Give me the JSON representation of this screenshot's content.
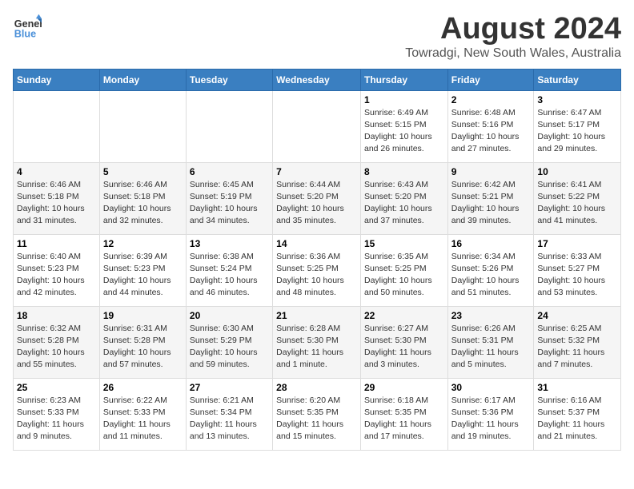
{
  "header": {
    "logo_line1": "General",
    "logo_line2": "Blue",
    "month_year": "August 2024",
    "location": "Towradgi, New South Wales, Australia"
  },
  "weekdays": [
    "Sunday",
    "Monday",
    "Tuesday",
    "Wednesday",
    "Thursday",
    "Friday",
    "Saturday"
  ],
  "weeks": [
    {
      "days": [
        {
          "num": "",
          "info": ""
        },
        {
          "num": "",
          "info": ""
        },
        {
          "num": "",
          "info": ""
        },
        {
          "num": "",
          "info": ""
        },
        {
          "num": "1",
          "info": "Sunrise: 6:49 AM\nSunset: 5:15 PM\nDaylight: 10 hours\nand 26 minutes."
        },
        {
          "num": "2",
          "info": "Sunrise: 6:48 AM\nSunset: 5:16 PM\nDaylight: 10 hours\nand 27 minutes."
        },
        {
          "num": "3",
          "info": "Sunrise: 6:47 AM\nSunset: 5:17 PM\nDaylight: 10 hours\nand 29 minutes."
        }
      ]
    },
    {
      "days": [
        {
          "num": "4",
          "info": "Sunrise: 6:46 AM\nSunset: 5:18 PM\nDaylight: 10 hours\nand 31 minutes."
        },
        {
          "num": "5",
          "info": "Sunrise: 6:46 AM\nSunset: 5:18 PM\nDaylight: 10 hours\nand 32 minutes."
        },
        {
          "num": "6",
          "info": "Sunrise: 6:45 AM\nSunset: 5:19 PM\nDaylight: 10 hours\nand 34 minutes."
        },
        {
          "num": "7",
          "info": "Sunrise: 6:44 AM\nSunset: 5:20 PM\nDaylight: 10 hours\nand 35 minutes."
        },
        {
          "num": "8",
          "info": "Sunrise: 6:43 AM\nSunset: 5:20 PM\nDaylight: 10 hours\nand 37 minutes."
        },
        {
          "num": "9",
          "info": "Sunrise: 6:42 AM\nSunset: 5:21 PM\nDaylight: 10 hours\nand 39 minutes."
        },
        {
          "num": "10",
          "info": "Sunrise: 6:41 AM\nSunset: 5:22 PM\nDaylight: 10 hours\nand 41 minutes."
        }
      ]
    },
    {
      "days": [
        {
          "num": "11",
          "info": "Sunrise: 6:40 AM\nSunset: 5:23 PM\nDaylight: 10 hours\nand 42 minutes."
        },
        {
          "num": "12",
          "info": "Sunrise: 6:39 AM\nSunset: 5:23 PM\nDaylight: 10 hours\nand 44 minutes."
        },
        {
          "num": "13",
          "info": "Sunrise: 6:38 AM\nSunset: 5:24 PM\nDaylight: 10 hours\nand 46 minutes."
        },
        {
          "num": "14",
          "info": "Sunrise: 6:36 AM\nSunset: 5:25 PM\nDaylight: 10 hours\nand 48 minutes."
        },
        {
          "num": "15",
          "info": "Sunrise: 6:35 AM\nSunset: 5:25 PM\nDaylight: 10 hours\nand 50 minutes."
        },
        {
          "num": "16",
          "info": "Sunrise: 6:34 AM\nSunset: 5:26 PM\nDaylight: 10 hours\nand 51 minutes."
        },
        {
          "num": "17",
          "info": "Sunrise: 6:33 AM\nSunset: 5:27 PM\nDaylight: 10 hours\nand 53 minutes."
        }
      ]
    },
    {
      "days": [
        {
          "num": "18",
          "info": "Sunrise: 6:32 AM\nSunset: 5:28 PM\nDaylight: 10 hours\nand 55 minutes."
        },
        {
          "num": "19",
          "info": "Sunrise: 6:31 AM\nSunset: 5:28 PM\nDaylight: 10 hours\nand 57 minutes."
        },
        {
          "num": "20",
          "info": "Sunrise: 6:30 AM\nSunset: 5:29 PM\nDaylight: 10 hours\nand 59 minutes."
        },
        {
          "num": "21",
          "info": "Sunrise: 6:28 AM\nSunset: 5:30 PM\nDaylight: 11 hours\nand 1 minute."
        },
        {
          "num": "22",
          "info": "Sunrise: 6:27 AM\nSunset: 5:30 PM\nDaylight: 11 hours\nand 3 minutes."
        },
        {
          "num": "23",
          "info": "Sunrise: 6:26 AM\nSunset: 5:31 PM\nDaylight: 11 hours\nand 5 minutes."
        },
        {
          "num": "24",
          "info": "Sunrise: 6:25 AM\nSunset: 5:32 PM\nDaylight: 11 hours\nand 7 minutes."
        }
      ]
    },
    {
      "days": [
        {
          "num": "25",
          "info": "Sunrise: 6:23 AM\nSunset: 5:33 PM\nDaylight: 11 hours\nand 9 minutes."
        },
        {
          "num": "26",
          "info": "Sunrise: 6:22 AM\nSunset: 5:33 PM\nDaylight: 11 hours\nand 11 minutes."
        },
        {
          "num": "27",
          "info": "Sunrise: 6:21 AM\nSunset: 5:34 PM\nDaylight: 11 hours\nand 13 minutes."
        },
        {
          "num": "28",
          "info": "Sunrise: 6:20 AM\nSunset: 5:35 PM\nDaylight: 11 hours\nand 15 minutes."
        },
        {
          "num": "29",
          "info": "Sunrise: 6:18 AM\nSunset: 5:35 PM\nDaylight: 11 hours\nand 17 minutes."
        },
        {
          "num": "30",
          "info": "Sunrise: 6:17 AM\nSunset: 5:36 PM\nDaylight: 11 hours\nand 19 minutes."
        },
        {
          "num": "31",
          "info": "Sunrise: 6:16 AM\nSunset: 5:37 PM\nDaylight: 11 hours\nand 21 minutes."
        }
      ]
    }
  ]
}
